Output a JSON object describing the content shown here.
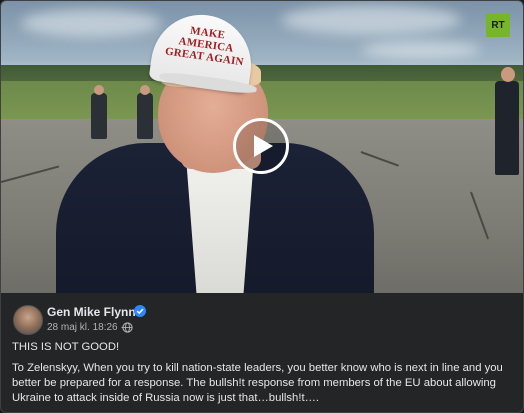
{
  "video": {
    "cap_line1": "MAKE AMERICA",
    "cap_line2": "GREAT AGAIN",
    "cap_color": "#a31e22",
    "logo_text": "RT",
    "logo_color": "#77b52a",
    "play_icon": "play-icon"
  },
  "post": {
    "author": "Gen Mike Flynn",
    "verified_icon": "verified-badge-icon",
    "timestamp": "28 maj kl. 18:26 ·",
    "audience_icon": "globe-icon",
    "paragraph1": "THIS IS NOT GOOD!",
    "paragraph2": "To Zelenskyy, When you try to kill nation-state leaders, you better know who is next in line and you better be prepared for a response. The bullsh!t response from members of the EU about allowing Ukraine to attack inside of Russia now is just that…bullsh!t…."
  }
}
